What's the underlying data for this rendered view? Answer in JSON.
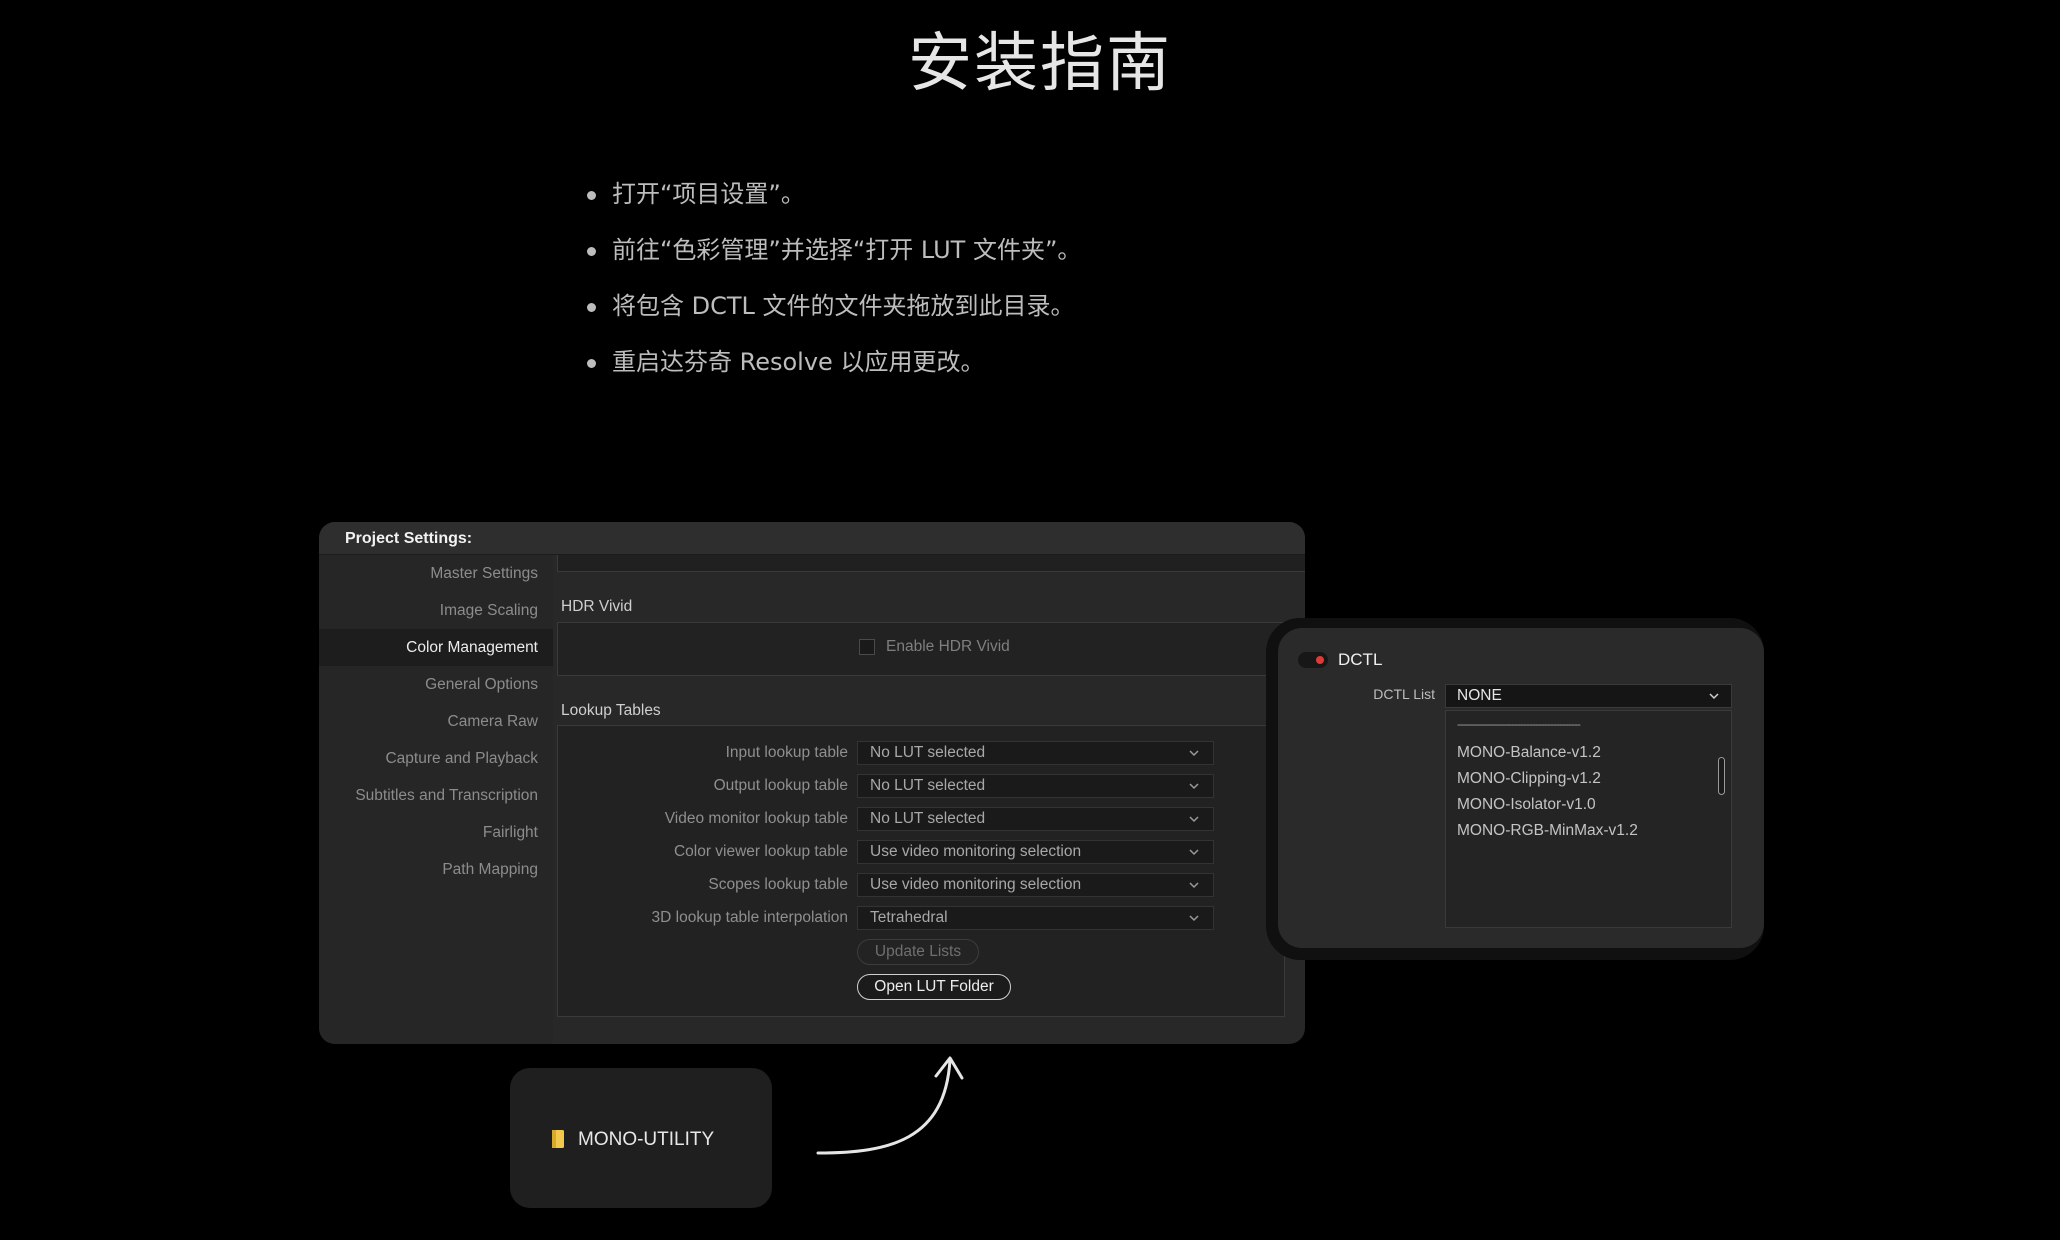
{
  "page": {
    "title": "安装指南",
    "steps": [
      "打开“项目设置”。",
      "前往“色彩管理”并选择“打开 LUT 文件夹”。",
      "将包含 DCTL 文件的文件夹拖放到此目录。",
      "重启达芬奇 Resolve 以应用更改。"
    ]
  },
  "project_settings": {
    "header": "Project Settings:",
    "sidebar": [
      "Master Settings",
      "Image Scaling",
      "Color Management",
      "General Options",
      "Camera Raw",
      "Capture and Playback",
      "Subtitles and Transcription",
      "Fairlight",
      "Path Mapping"
    ],
    "active_item": "Color Management",
    "hdr_section": "HDR Vivid",
    "hdr_checkbox_label": "Enable HDR Vivid",
    "lut_section": "Lookup Tables",
    "lut_rows": [
      {
        "label": "Input lookup table",
        "value": "No LUT selected"
      },
      {
        "label": "Output lookup table",
        "value": "No LUT selected"
      },
      {
        "label": "Video monitor lookup table",
        "value": "No LUT selected"
      },
      {
        "label": "Color viewer lookup table",
        "value": "Use video monitoring selection"
      },
      {
        "label": "Scopes lookup table",
        "value": "Use video monitoring selection"
      },
      {
        "label": "3D lookup table interpolation",
        "value": "Tetrahedral"
      }
    ],
    "update_lists_button": "Update Lists",
    "open_lut_button": "Open LUT Folder"
  },
  "dctl": {
    "title": "DCTL",
    "list_label": "DCTL List",
    "selected": "NONE",
    "separator": "-----------------------------------------",
    "items": [
      "MONO-Balance-v1.2",
      "MONO-Clipping-v1.2",
      "MONO-Isolator-v1.0",
      "MONO-RGB-MinMax-v1.2"
    ],
    "toggle_color": "#e03a35"
  },
  "folder": {
    "name": "MONO-UTILITY",
    "icon": "folder-icon",
    "icon_color": "#f2c94c"
  }
}
